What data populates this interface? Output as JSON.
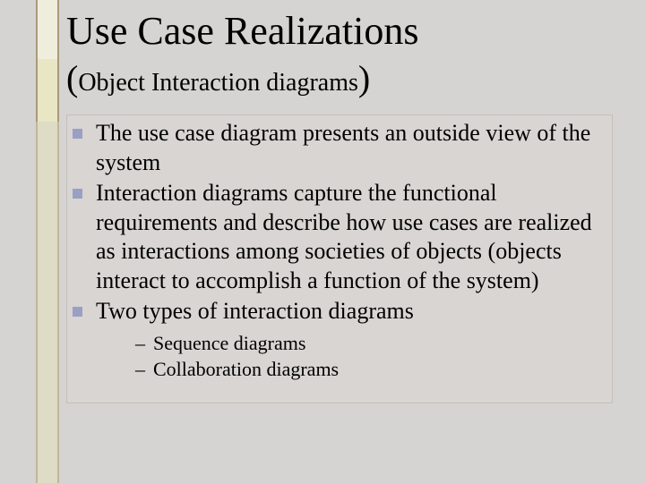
{
  "title": "Use Case Realizations",
  "subtitle_inner": "Object Interaction diagrams",
  "paren_open": "(",
  "paren_close": ")",
  "bullets": [
    "The use case diagram presents an outside view of the system",
    "Interaction diagrams capture the functional requirements and describe how use cases are realized as interactions among societies of objects (objects interact to accomplish a function of the system)",
    "Two types of interaction diagrams"
  ],
  "sub_bullets": [
    "Sequence diagrams",
    "Collaboration diagrams"
  ],
  "dash": "–"
}
